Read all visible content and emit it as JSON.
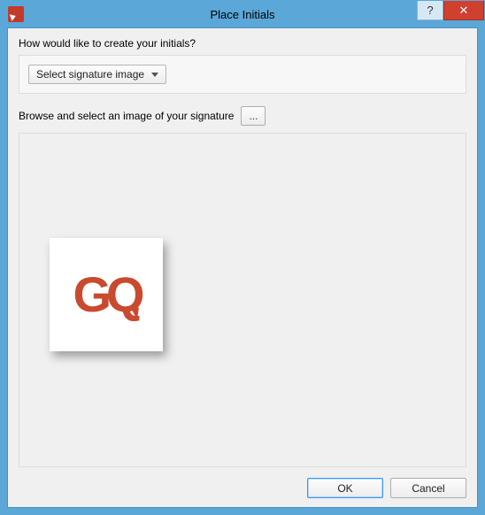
{
  "window": {
    "title": "Place Initials",
    "help_glyph": "?",
    "close_glyph": "✕"
  },
  "question": "How would like to create your initials?",
  "dropdown": {
    "selected": "Select signature image"
  },
  "browse": {
    "label": "Browse and select an image of your signature",
    "button": "..."
  },
  "preview": {
    "logo_text": "GQ"
  },
  "buttons": {
    "ok": "OK",
    "cancel": "Cancel"
  }
}
